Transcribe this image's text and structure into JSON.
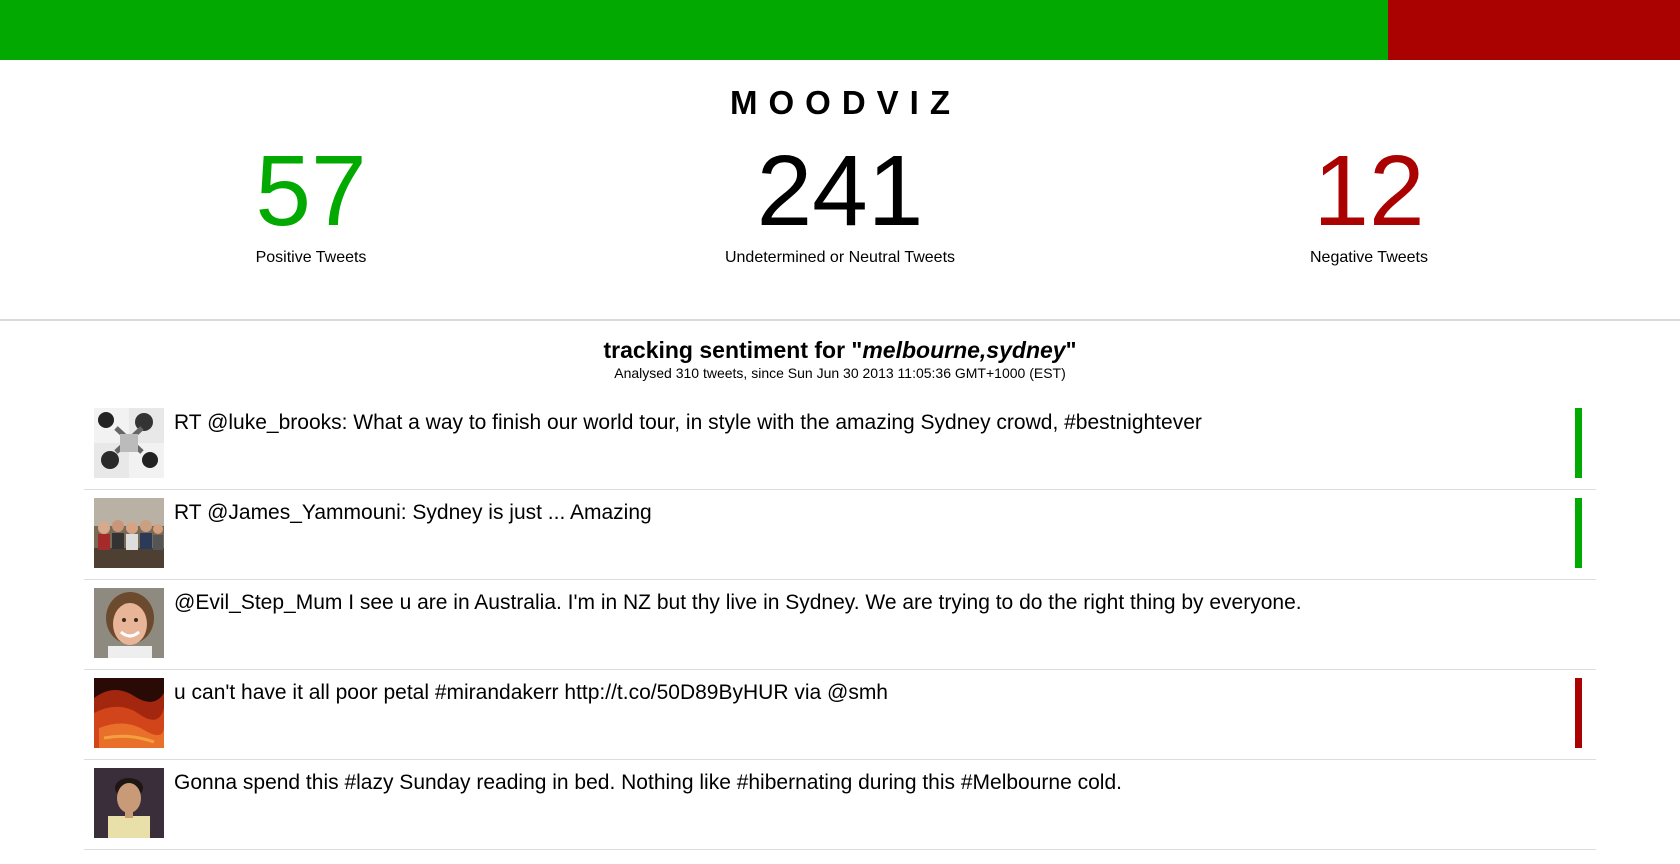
{
  "sentiment_bar": {
    "positive_color": "#02a901",
    "negative_color": "#a90200"
  },
  "app": {
    "logo": "MOODVIZ"
  },
  "stats": {
    "positive": {
      "value": "57",
      "label": "Positive Tweets",
      "color": "#02a901"
    },
    "neutral": {
      "value": "241",
      "label": "Undetermined or Neutral Tweets",
      "color": "#000000"
    },
    "negative": {
      "value": "12",
      "label": "Negative Tweets",
      "color": "#a90200"
    }
  },
  "tracking": {
    "prefix": "tracking sentiment for \"",
    "query": "melbourne,sydney",
    "suffix": "\"",
    "summary": "Analysed 310 tweets, since Sun Jun 30 2013 11:05:36 GMT+1000 (EST)"
  },
  "tweets": [
    {
      "text": "RT @luke_brooks: What a way to finish our world tour, in style with the amazing Sydney crowd, #bestnightever",
      "sentiment": "positive",
      "avatar_icon": "bw-hands-avatar"
    },
    {
      "text": "RT @James_Yammouni: Sydney is just ... Amazing",
      "sentiment": "positive",
      "avatar_icon": "group-photo-avatar"
    },
    {
      "text": "@Evil_Step_Mum I see u are in Australia. I'm in NZ but thy live in Sydney. We are trying to do the right thing by everyone.",
      "sentiment": "neutral",
      "avatar_icon": "smiling-woman-avatar"
    },
    {
      "text": "u can't have it all poor petal #mirandakerr http://t.co/50D89ByHUR via @smh",
      "sentiment": "negative",
      "avatar_icon": "red-hair-avatar"
    },
    {
      "text": "Gonna spend this #lazy Sunday reading in bed. Nothing like #hibernating during this #Melbourne cold.",
      "sentiment": "neutral",
      "avatar_icon": "man-portrait-avatar"
    }
  ]
}
